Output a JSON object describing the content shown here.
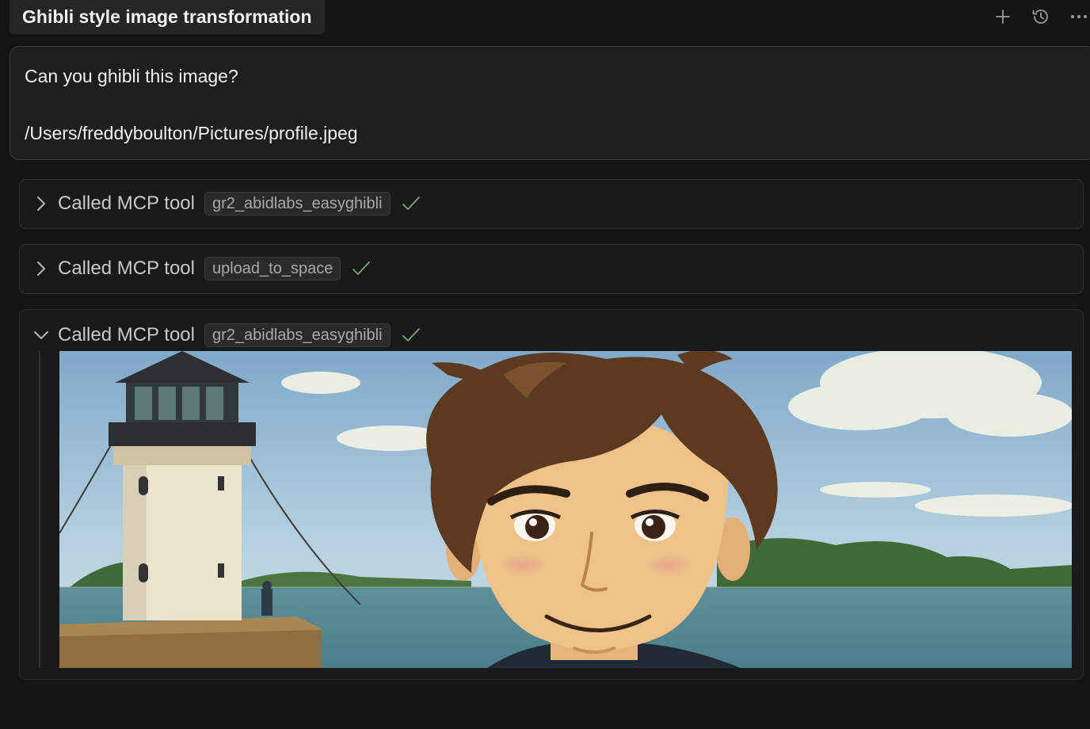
{
  "header": {
    "chat_title": "Ghibli style image transformation",
    "icons": [
      "plus-icon",
      "history-icon",
      "more-icon"
    ]
  },
  "user_message": {
    "line1": "Can you ghibli this image?",
    "line2": "/Users/freddyboulton/Pictures/profile.jpeg"
  },
  "tool_calls": [
    {
      "label": "Called MCP tool",
      "tool_name": "gr2_abidlabs_easyghibli",
      "expanded": false,
      "status": "success"
    },
    {
      "label": "Called MCP tool",
      "tool_name": "upload_to_space",
      "expanded": false,
      "status": "success"
    },
    {
      "label": "Called MCP tool",
      "tool_name": "gr2_abidlabs_easyghibli",
      "expanded": true,
      "status": "success"
    }
  ],
  "colors": {
    "background": "#141414",
    "card": "#191919",
    "border": "#2f2f2f",
    "success": "#6fae6f"
  }
}
